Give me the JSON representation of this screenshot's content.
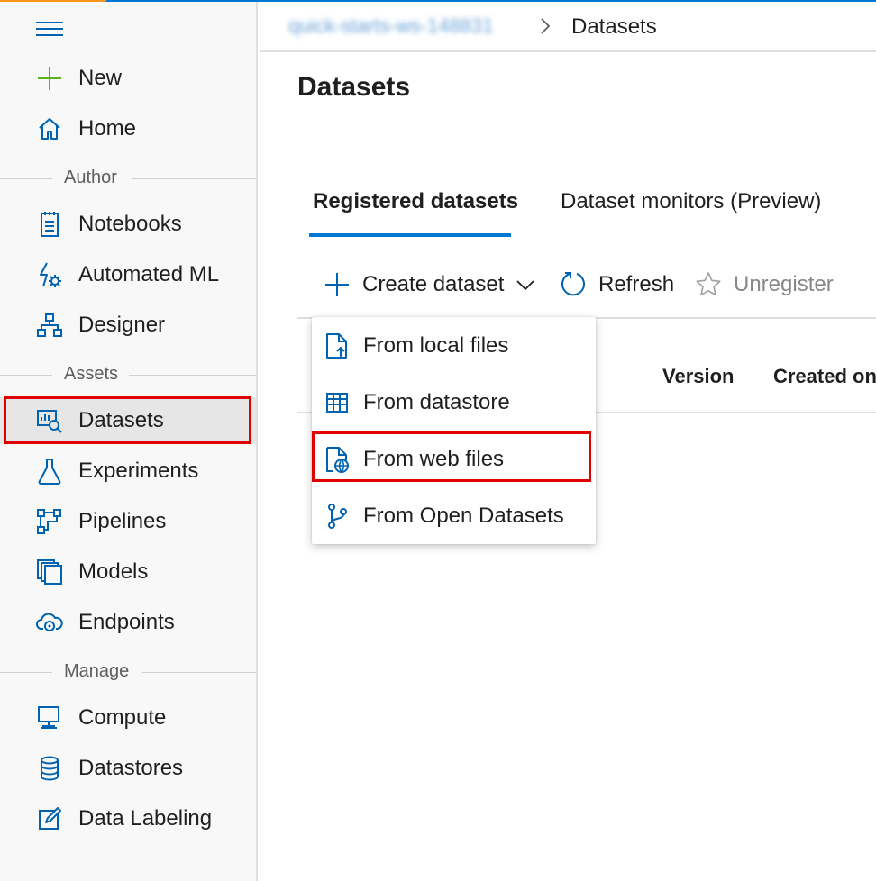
{
  "breadcrumb": {
    "workspace": "quick-starts-ws-148831",
    "current": "Datasets"
  },
  "sidebar": {
    "items": [
      {
        "label": "New",
        "icon": "plus-icon"
      },
      {
        "label": "Home",
        "icon": "home-icon"
      },
      {
        "label": "Notebooks",
        "icon": "notebook-icon"
      },
      {
        "label": "Automated ML",
        "icon": "automated-ml-icon"
      },
      {
        "label": "Designer",
        "icon": "designer-icon"
      },
      {
        "label": "Datasets",
        "icon": "datasets-icon",
        "selected": true
      },
      {
        "label": "Experiments",
        "icon": "flask-icon"
      },
      {
        "label": "Pipelines",
        "icon": "pipeline-icon"
      },
      {
        "label": "Models",
        "icon": "models-icon"
      },
      {
        "label": "Endpoints",
        "icon": "endpoint-cloud-icon"
      },
      {
        "label": "Compute",
        "icon": "compute-monitor-icon"
      },
      {
        "label": "Datastores",
        "icon": "database-icon"
      },
      {
        "label": "Data Labeling",
        "icon": "edit-label-icon"
      }
    ],
    "sections": {
      "author": "Author",
      "assets": "Assets",
      "manage": "Manage"
    }
  },
  "page": {
    "title": "Datasets"
  },
  "tabs": [
    {
      "label": "Registered datasets",
      "active": true
    },
    {
      "label": "Dataset monitors (Preview)",
      "active": false
    }
  ],
  "toolbar": {
    "create": "Create dataset",
    "refresh": "Refresh",
    "unregister": "Unregister"
  },
  "grid": {
    "columns": [
      "Version",
      "Created on"
    ]
  },
  "create_menu": {
    "items": [
      {
        "label": "From local files",
        "icon": "file-upload-icon"
      },
      {
        "label": "From datastore",
        "icon": "table-icon"
      },
      {
        "label": "From web files",
        "icon": "web-file-icon",
        "highlighted": true
      },
      {
        "label": "From Open Datasets",
        "icon": "open-datasets-icon"
      }
    ]
  },
  "colors": {
    "accent": "#0078d4",
    "icon_blue": "#0063b1",
    "new_green": "#5db318",
    "highlight_red": "#e00000"
  }
}
